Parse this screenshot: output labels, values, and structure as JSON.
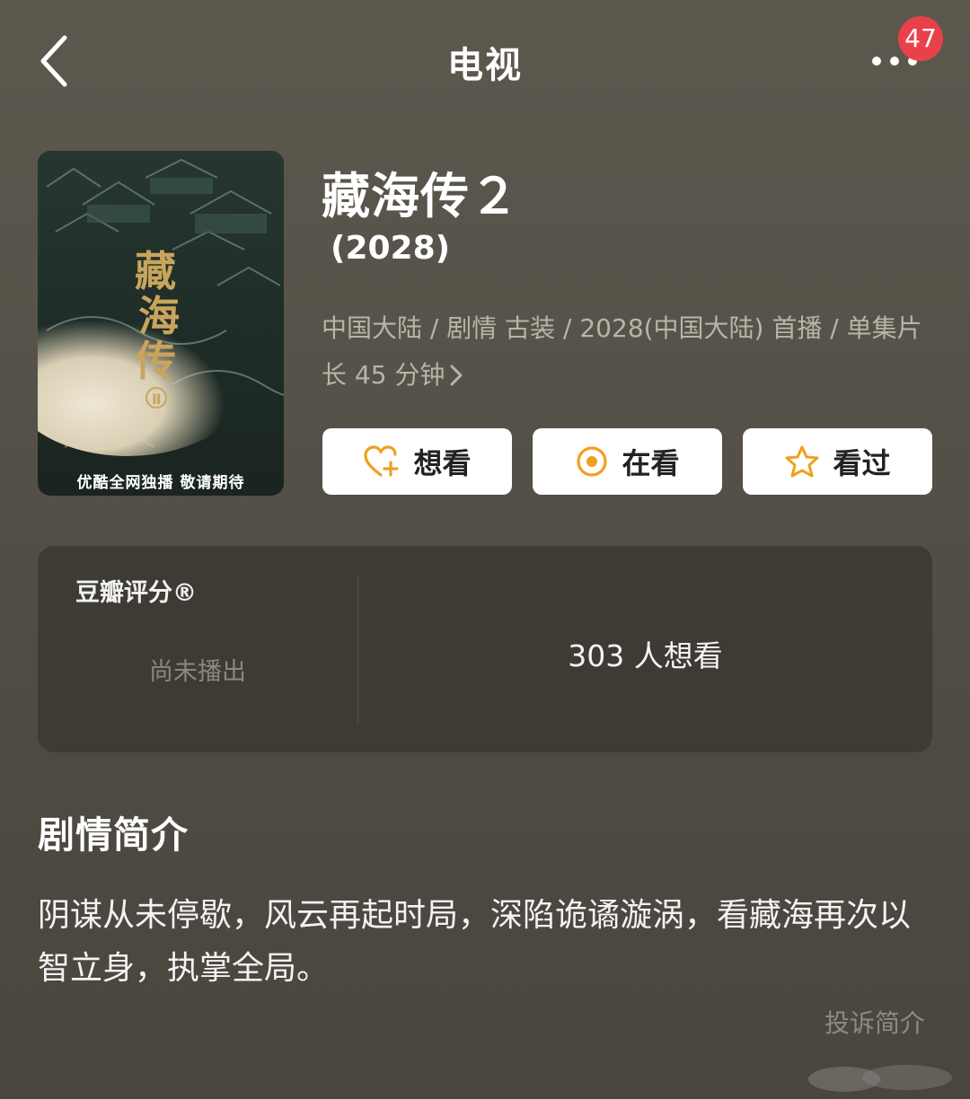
{
  "header": {
    "back_icon": "chevron-left-icon",
    "title": "电视",
    "more_icon": "more-dots-icon",
    "notification_count": "47"
  },
  "poster": {
    "caption": "优酷全网独播 敬请期待",
    "calligraphy": "藏海传"
  },
  "show": {
    "title": "藏海传２",
    "year": "(2028)",
    "meta": "中国大陆 / 剧情 古装 / 2028(中国大陆) 首播 / 单集片长 45 分钟"
  },
  "actions": [
    {
      "label": "想看",
      "icon": "heart-plus-icon"
    },
    {
      "label": "在看",
      "icon": "target-circle-icon"
    },
    {
      "label": "看过",
      "icon": "star-icon"
    }
  ],
  "rating": {
    "label": "豆瓣评分®",
    "status": "尚未播出",
    "want_count": "303 人想看"
  },
  "synopsis": {
    "heading": "剧情简介",
    "text": "阴谋从未停歇，风云再起时局，深陷诡谲漩涡，看藏海再次以智立身，执掌全局。",
    "report_link": "投诉简介"
  },
  "colors": {
    "background": "#57534a",
    "card": "#3e3b35",
    "accent": "#f0a020",
    "badge": "#e8414a"
  }
}
